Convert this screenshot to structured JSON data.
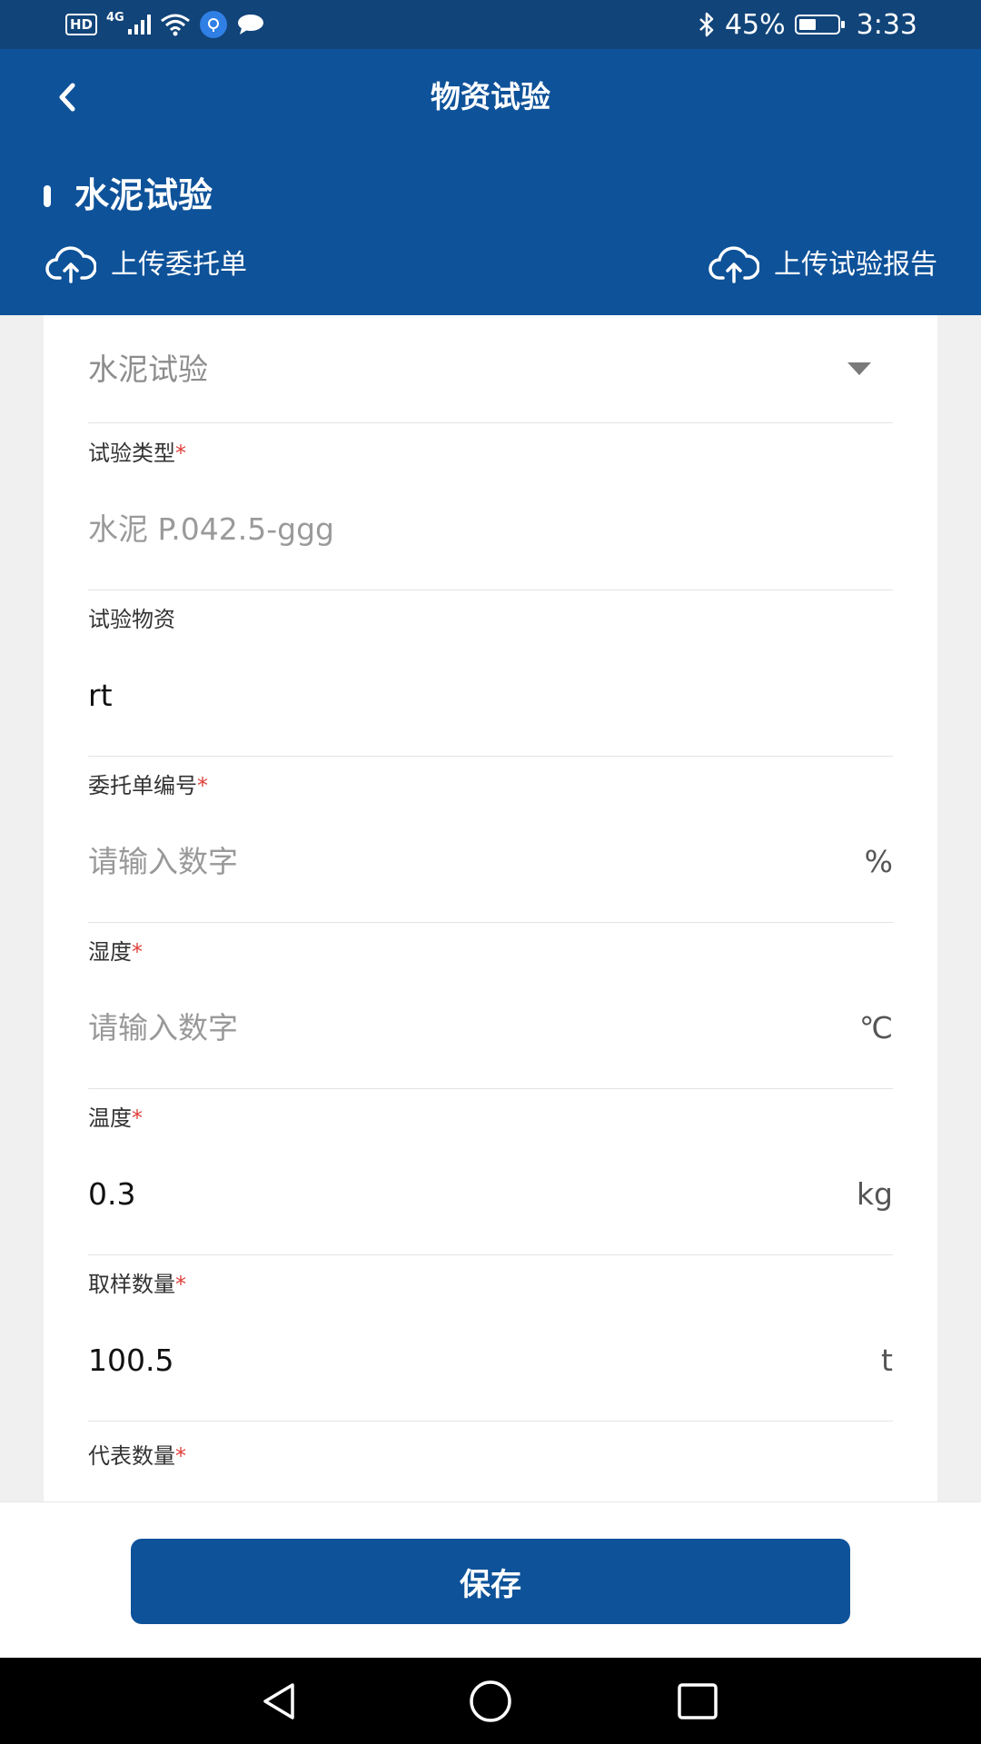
{
  "status_bar": {
    "hd": "HD",
    "network": "4G",
    "battery_percent": "45%",
    "battery_level": 0.45,
    "time": "3:33",
    "icons": [
      "hd-icon",
      "signal-icon",
      "wifi-icon",
      "location-icon",
      "chat-icon",
      "bluetooth-icon",
      "battery-icon"
    ]
  },
  "header": {
    "title": "物资试验",
    "section_title": "水泥试验",
    "upload_commission": "上传委托单",
    "upload_report": "上传试验报告"
  },
  "form": {
    "selected_test": "水泥试验",
    "fields": [
      {
        "label": "试验类型",
        "required": "*",
        "value": "水泥 P.042.5-ggg",
        "unit": ""
      },
      {
        "label": "试验物资",
        "required": "",
        "value": "rt",
        "unit": ""
      },
      {
        "label": "委托单编号",
        "required": "*",
        "value": "请输入数字",
        "unit": "%"
      },
      {
        "label": "湿度",
        "required": "*",
        "value": "请输入数字",
        "unit": "℃"
      },
      {
        "label": "温度",
        "required": "*",
        "value": "0.3",
        "unit": "kg"
      },
      {
        "label": "取样数量",
        "required": "*",
        "value": "100.5",
        "unit": "t"
      }
    ],
    "last_label": "代表数量",
    "last_required": "*"
  },
  "save_label": "保存",
  "colors": {
    "primary": "#0e5299",
    "status_bar": "#114479",
    "required": "#e0403a"
  }
}
